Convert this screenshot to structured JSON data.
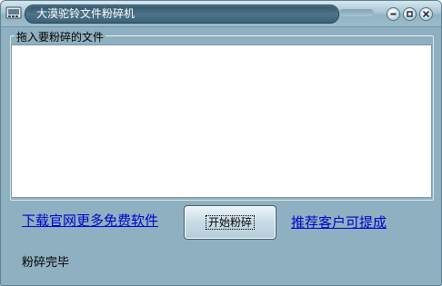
{
  "window": {
    "title": "大漠驼铃文件粉碎机",
    "icon": "app-icon"
  },
  "controls": {
    "minimize_icon": "minimize-icon",
    "maximize_icon": "maximize-icon",
    "close_icon": "close-icon"
  },
  "drop_group": {
    "label": "拖入要粉碎的文件"
  },
  "footer": {
    "download_link": "下载官网更多免费软件",
    "start_button": "开始粉碎",
    "recommend_link": "推荐客户可提成",
    "status": "粉碎完毕"
  }
}
